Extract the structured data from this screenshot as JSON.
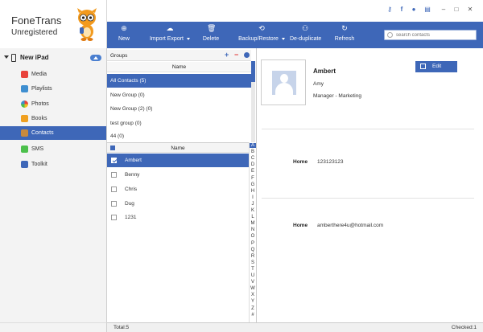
{
  "app": {
    "name": "FoneTrans",
    "registration": "Unregistered"
  },
  "window_icons": [
    "key-icon",
    "facebook-icon",
    "chat-icon",
    "feedback-icon",
    "minimize-icon",
    "maximize-icon",
    "close-icon"
  ],
  "device": {
    "label": "New iPad"
  },
  "sidebar": {
    "items": [
      {
        "label": "Media",
        "icon": "music-icon",
        "color": "#e8423b"
      },
      {
        "label": "Playlists",
        "icon": "playlist-icon",
        "color": "#3e8ed0"
      },
      {
        "label": "Photos",
        "icon": "photos-icon",
        "color": "#e89a2c"
      },
      {
        "label": "Books",
        "icon": "books-icon",
        "color": "#f0a020"
      },
      {
        "label": "Contacts",
        "icon": "contacts-icon",
        "color": "#c98a3e"
      },
      {
        "label": "SMS",
        "icon": "sms-icon",
        "color": "#4cc04c"
      },
      {
        "label": "Toolkit",
        "icon": "toolkit-icon",
        "color": "#3e67b8"
      }
    ],
    "active": "Contacts"
  },
  "toolbar": {
    "new": "New",
    "import_export": "Import Export",
    "delete": "Delete",
    "backup_restore": "Backup/Restore",
    "deduplicate": "De-duplicate",
    "refresh": "Refresh",
    "search_placeholder": "search contacts"
  },
  "groups": {
    "title": "Groups",
    "column": "Name",
    "items": [
      "All Contacts  (5)",
      "New Group  (0)",
      "New Group (2)  (0)",
      "test group  (0)",
      "44  (0)"
    ]
  },
  "contacts": {
    "column": "Name",
    "items": [
      "Ambert",
      "Benny",
      "Chris",
      "Dug",
      "1231"
    ],
    "selected": "Ambert"
  },
  "alphabet": [
    "A",
    "B",
    "C",
    "D",
    "E",
    "F",
    "G",
    "H",
    "I",
    "J",
    "K",
    "L",
    "M",
    "N",
    "O",
    "P",
    "Q",
    "R",
    "S",
    "T",
    "U",
    "V",
    "W",
    "X",
    "Y",
    "Z",
    "#"
  ],
  "detail": {
    "name": "Ambert",
    "first_name": "Amy",
    "title": "Manager - Marketing",
    "edit": "Edit",
    "fields": [
      {
        "label": "Home",
        "value": "123123123"
      },
      {
        "label": "Home",
        "value": "amberthere4u@hotmail.com"
      }
    ]
  },
  "status": {
    "total": "Total:5",
    "checked": "Checked:1"
  },
  "colors": {
    "accent": "#3e67b8",
    "danger": "#e03030",
    "success": "#3aa04a"
  }
}
